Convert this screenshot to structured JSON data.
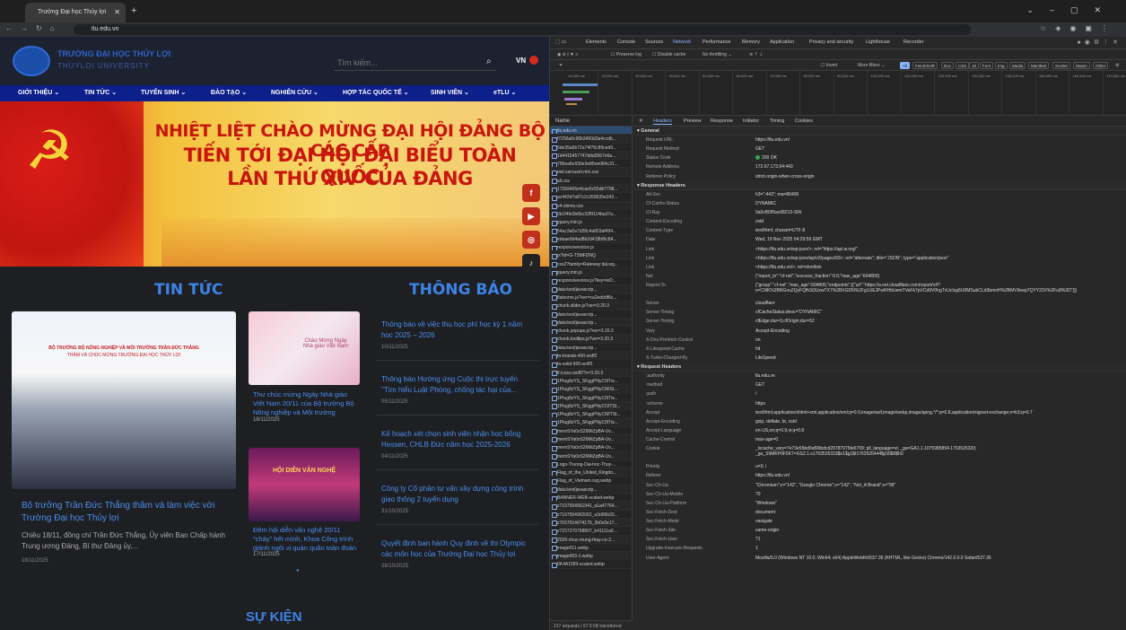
{
  "browser": {
    "tab_title": "Trường Đại học Thủy lợi",
    "url": "tlu.edu.vn"
  },
  "site": {
    "logo_title": "TRƯỜNG ĐẠI HỌC THỦY LỢI",
    "logo_subtitle": "THUYLOI UNIVERSITY",
    "search_placeholder": "Tìm kiếm...",
    "lang": "VN",
    "nav": [
      "GIỚI THIỆU",
      "TIN TỨC",
      "TUYỂN SINH",
      "ĐÀO TẠO",
      "NGHIÊN CỨU",
      "HỢP TÁC QUỐC TẾ",
      "SINH VIÊN",
      "eTLU"
    ],
    "banner_lines": [
      "NHIỆT LIỆT CHÀO MỪNG ĐẠI HỘI ĐẢNG BỘ CÁC CẤP",
      "TIẾN TỚI ĐẠI HỘI ĐẠI BIỂU TOÀN QUỐC",
      "LẦN THỨ XIV CỦA ĐẢNG"
    ],
    "social": [
      "f",
      "▶",
      "◎",
      "♪"
    ],
    "news_title_heading": "TIN TỨC",
    "notice_heading": "THÔNG BÁO",
    "events_heading": "SỰ KIỆN",
    "main_news": {
      "img_line1": "BỘ TRƯỞNG BỘ NÔNG NGHIỆP VÀ MÔI TRƯỜNG TRẦN ĐỨC THẮNG",
      "img_line2": "THĂM VÀ CHÚC MỪNG TRƯỜNG ĐẠI HỌC THỦY LỢI",
      "title": "Bộ trưởng Trần Đức Thắng thăm và làm việc với Trường Đại học Thủy lợi",
      "summary": "Chiều 18/11, đồng chí Trần Đức Thắng, Ủy viên Ban Chấp hành Trung ương Đảng, Bí thư Đảng ủy,...",
      "date": "18/11/2025"
    },
    "side_news": [
      {
        "title": "Thư chúc mừng Ngày Nhà giáo Việt Nam 20/11 của Bộ trưởng Bộ Nông nghiệp và Môi trường",
        "date": "18/11/2025",
        "img_text": "Chào Mừng Ngày Nhà giáo Việt Nam"
      },
      {
        "title": "Đêm hội diễn văn nghệ 20/11 \"cháy\" hết mình, Khoa Công trình giành ngôi vị quán quân toàn đoàn",
        "date": "17/11/2025",
        "img_text": "HỘI DIỄN VĂN NGHỆ"
      }
    ],
    "notices": [
      {
        "title": "Thông báo về việc thu học phí học kỳ 1 năm học 2025 – 2026",
        "date": "10/11/2025"
      },
      {
        "title": "Thông báo Hướng ứng Cuộc thi trực tuyến \"Tìm hiểu Luật Phòng, chống tác hại của...",
        "date": "05/11/2025"
      },
      {
        "title": "Kế hoạch xét chọn sinh viên nhận học bổng Hessen, CHLB Đức năm học 2025-2026",
        "date": "04/11/2025"
      },
      {
        "title": "Công ty Cổ phần tư vấn xây dựng công trình giao thông 2 tuyển dụng",
        "date": "31/10/2025"
      },
      {
        "title": "Quyết định ban hành Quy định về thi Olympic các môn học của Trường Đại học Thủy lợi",
        "date": "28/10/2025"
      }
    ]
  },
  "devtools": {
    "tabs": [
      "Elements",
      "Console",
      "Sources",
      "Network",
      "Performance",
      "Memory",
      "Application",
      "Privacy and security",
      "Lighthouse",
      "Recorder"
    ],
    "active_tab": "Network",
    "filter": {
      "preserve_log": "Preserve log",
      "disable_cache": "Disable cache",
      "throttle": "No throttling",
      "invert": "Invert",
      "more_filters": "More filters"
    },
    "type_chips": [
      "All",
      "Fetch/XHR",
      "Doc",
      "CSS",
      "JS",
      "Font",
      "Img",
      "Media",
      "Manifest",
      "Socket",
      "Wasm",
      "Other"
    ],
    "timeline_ticks": [
      "10,000 ms",
      "20,000 ms",
      "30,000 ms",
      "40,000 ms",
      "50,000 ms",
      "60,000 ms",
      "70,000 ms",
      "80,000 ms",
      "90,000 ms",
      "100,000 ms",
      "110,000 ms",
      "120,000 ms",
      "130,000 ms",
      "140,000 ms",
      "150,000 ms",
      "160,000 ms",
      "170,000 ms"
    ],
    "name_header": "Name",
    "requests": [
      "tlu.edu.vn",
      "f7256a0c90b3493d3a4ccdb...",
      "5de35a6b72a74f76c89ced9...",
      "1d4415457747dda5567e6a...",
      "706ea6e930e3e85ee084c31...",
      "owl.carousel.min.css",
      "all.css",
      "172b9465e4cae5c55db7798...",
      "ac442d7a87c2c359635e243...",
      "v4-shims.css",
      "0b1f4fe3b6bc32f9114ba37a...",
      "jquery.min.js",
      "54ac3a0a7d28c4a803af494...",
      "edaae9d4ad8b2d418bf6c84...",
      "responsivevoice.js",
      "js?id=G-T3MFDNQ",
      "css2?family=Raleway:ital,wg...",
      "jquery.min.js",
      "responsivevoice.js?key=ieD...",
      "data:text/javascrip...",
      "flatsome.js?ver=ca2edddf6c...",
      "chunk.slider.js?ver=3.20.3",
      "data:text/javascrip...",
      "data:text/javascrip...",
      "chunk.popups.js?ver=3.20.3",
      "chunk.tooltips.js?ver=3.20.3",
      "data:text/javascrip...",
      "fa-brands-400.woff2",
      "fa-solid-900.woff2",
      "fl-icons.woff2?v=3.20.3",
      "1Ptug8zYS_SKggPNyC0ITw...",
      "1Ptug8zYS_SKggPNyCMISt...",
      "1Ptug8zYS_SKggPNyC0ITw...",
      "1Ptug8zYS_SKggPNyCOITSt...",
      "1Ptug8zYS_SKggPNyCMITSt...",
      "1Ptug8zYS_SKggPNyC0ITw...",
      "memSYa0sS26MiZpBA-Uv...",
      "memSYa0sS26MiZpBA-Uv...",
      "memSYa0sS26MiZpBA-Uv...",
      "memSYa0sS26MiZpBA-Uv...",
      "Logo-Truong-Dai-hoc-Thuy-...",
      "Flag_of_the_United_Kingdo...",
      "Flag_of_Vietnam.svg.webp",
      "data:text/javascrip...",
      "BANNER-WEB-scaled.webp",
      "z7197554961941_a1a47764...",
      "z7197554962062_a3d06b33...",
      "z7037514074176_3b0c0e17...",
      "z7237279758807_b41111a0...",
      "2026-chuc-mung-thay-co-2...",
      "image011.webp",
      "image003-1.webp",
      "0K4A1583-scaled.webp"
    ],
    "footer": "217 requests | 57.9 kB transferred",
    "detail_tabs": [
      "Headers",
      "Preview",
      "Response",
      "Initiator",
      "Timing",
      "Cookies"
    ],
    "general": {
      "title": "▾ General",
      "rows": [
        [
          "Request URL",
          "https://tlu.edu.vn/"
        ],
        [
          "Request Method",
          "GET"
        ],
        [
          "Status Code",
          "200 OK"
        ],
        [
          "Remote Address",
          "172.67.173.94:443"
        ],
        [
          "Referrer Policy",
          "strict-origin-when-cross-origin"
        ]
      ]
    },
    "response": {
      "title": "▾ Response Headers",
      "rows": [
        [
          "Alt-Svc",
          "h3=\":443\"; ma=86400"
        ],
        [
          "Cf-Cache-Status",
          "DYNAMIC"
        ],
        [
          "Cf-Ray",
          "9a0cf83f9ac68213-SIN"
        ],
        [
          "Content-Encoding",
          "zstd"
        ],
        [
          "Content-Type",
          "text/html; charset=UTF-8"
        ],
        [
          "Date",
          "Wed, 19 Nov 2025 04:29:59 GMT"
        ],
        [
          "Link",
          "<https://tlu.edu.vn/wp-json/>; rel=\"https://api.w.org/\""
        ],
        [
          "Link",
          "<https://tlu.edu.vn/wp-json/wp/v2/pages/93>; rel=\"alternate\"; title=\"JSON\"; type=\"application/json\""
        ],
        [
          "Link",
          "<https://tlu.edu.vn/>; rel=shortlink"
        ],
        [
          "Nel",
          "{\"report_to\":\"cf-nel\",\"success_fraction\":0.0,\"max_age\":604800}"
        ],
        [
          "Report-To",
          "{\"group\":\"cf-nel\",\"max_age\":604800,\"endpoints\":[{\"url\":\"https://a.nel.cloudflare.com/report/v4?s=C9lK%2BRGou2QyFQfh3i3UzwTX7%2BXGDN%2Fg1UEJPwRHbUemTVeFk7pVCd9V0hgTxUcIsg6U0MSubCLd3bmoH%2BMV9eep7QYY22X%2Fu8%3D\"}]}"
        ],
        [
          "Server",
          "cloudflare"
        ],
        [
          "Server-Timing",
          "cfCacheStatus;desc=\"DYNAMIC\""
        ],
        [
          "Server-Timing",
          "cfEdge;dur=3,cfOrigin;dur=52"
        ],
        [
          "Vary",
          "Accept-Encoding"
        ],
        [
          "X-Dns-Prefetch-Control",
          "on"
        ],
        [
          "X-Litespeed-Cache",
          "hit"
        ],
        [
          "X-Turbo-Charged-By",
          "LiteSpeed"
        ]
      ]
    },
    "request": {
      "title": "▾ Request Headers",
      "rows": [
        [
          ":authority",
          "tlu.edu.vn"
        ],
        [
          ":method",
          "GET"
        ],
        [
          ":path",
          "/"
        ],
        [
          ":scheme",
          "https"
        ],
        [
          "Accept",
          "text/html,application/xhtml+xml,application/xml;q=0.9,image/avif,image/webp,image/apng,*/*;q=0.8,application/signed-exchange;v=b3;q=0.7"
        ],
        [
          "Accept-Encoding",
          "gzip, deflate, br, zstd"
        ],
        [
          "Accept-Language",
          "en-US,en;q=0.9,vi;q=0.8"
        ],
        [
          "Cache-Control",
          "max-age=0"
        ],
        [
          "Cookie",
          "_lscache_vary=7e73e55bd9af90bdcd29787975fe6709; pll_language=vi; _ga=GA1.1.1075985854.1763526320; _ga_S9MKP0F5K7=GS2.1.s1763526319$o1$g1$t1763526444$j18$l0$h0"
        ],
        [
          "Priority",
          "u=0, i"
        ],
        [
          "Referer",
          "https://tlu.edu.vn/"
        ],
        [
          "Sec-Ch-Ua",
          "\"Chromium\";v=\"142\", \"Google Chrome\";v=\"142\", \"Not_A Brand\";v=\"99\""
        ],
        [
          "Sec-Ch-Ua-Mobile",
          "?0"
        ],
        [
          "Sec-Ch-Ua-Platform",
          "\"Windows\""
        ],
        [
          "Sec-Fetch-Dest",
          "document"
        ],
        [
          "Sec-Fetch-Mode",
          "navigate"
        ],
        [
          "Sec-Fetch-Site",
          "same-origin"
        ],
        [
          "Sec-Fetch-User",
          "?1"
        ],
        [
          "Upgrade-Insecure-Requests",
          "1"
        ],
        [
          "User-Agent",
          "Mozilla/5.0 (Windows NT 10.0; Win64; x64) AppleWebKit/537.36 (KHTML, like Gecko) Chrome/142.0.0.0 Safari/537.36"
        ]
      ]
    }
  }
}
